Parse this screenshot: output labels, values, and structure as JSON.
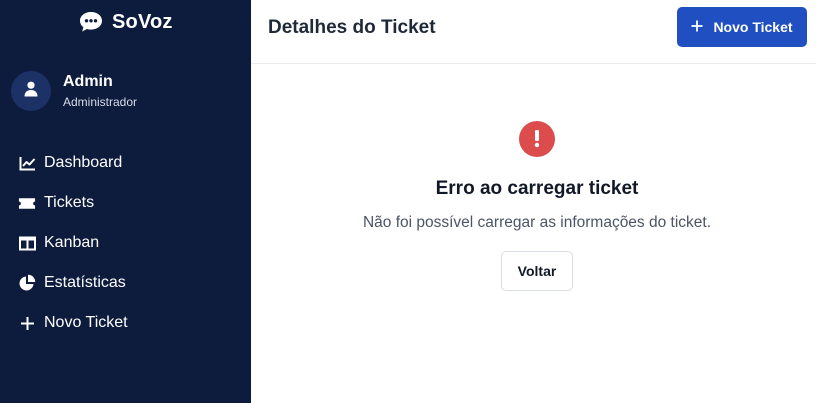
{
  "app": {
    "name": "SoVoz",
    "logo_icon": "speech-bubble-icon"
  },
  "user": {
    "name": "Admin",
    "role": "Administrador",
    "avatar_icon": "user-icon"
  },
  "sidebar": {
    "items": [
      {
        "label": "Dashboard",
        "icon": "chart-line-icon"
      },
      {
        "label": "Tickets",
        "icon": "ticket-icon"
      },
      {
        "label": "Kanban",
        "icon": "columns-icon"
      },
      {
        "label": "Estatísticas",
        "icon": "pie-chart-icon"
      },
      {
        "label": "Novo Ticket",
        "icon": "plus-icon"
      }
    ]
  },
  "header": {
    "title": "Detalhes do Ticket",
    "new_ticket_label": "Novo Ticket"
  },
  "error": {
    "title": "Erro ao carregar ticket",
    "message": "Não foi possível carregar as informações do ticket.",
    "back_label": "Voltar"
  },
  "colors": {
    "sidebar_bg": "#0d1b3d",
    "primary": "#1f4fc0",
    "error": "#dc4c4c"
  }
}
